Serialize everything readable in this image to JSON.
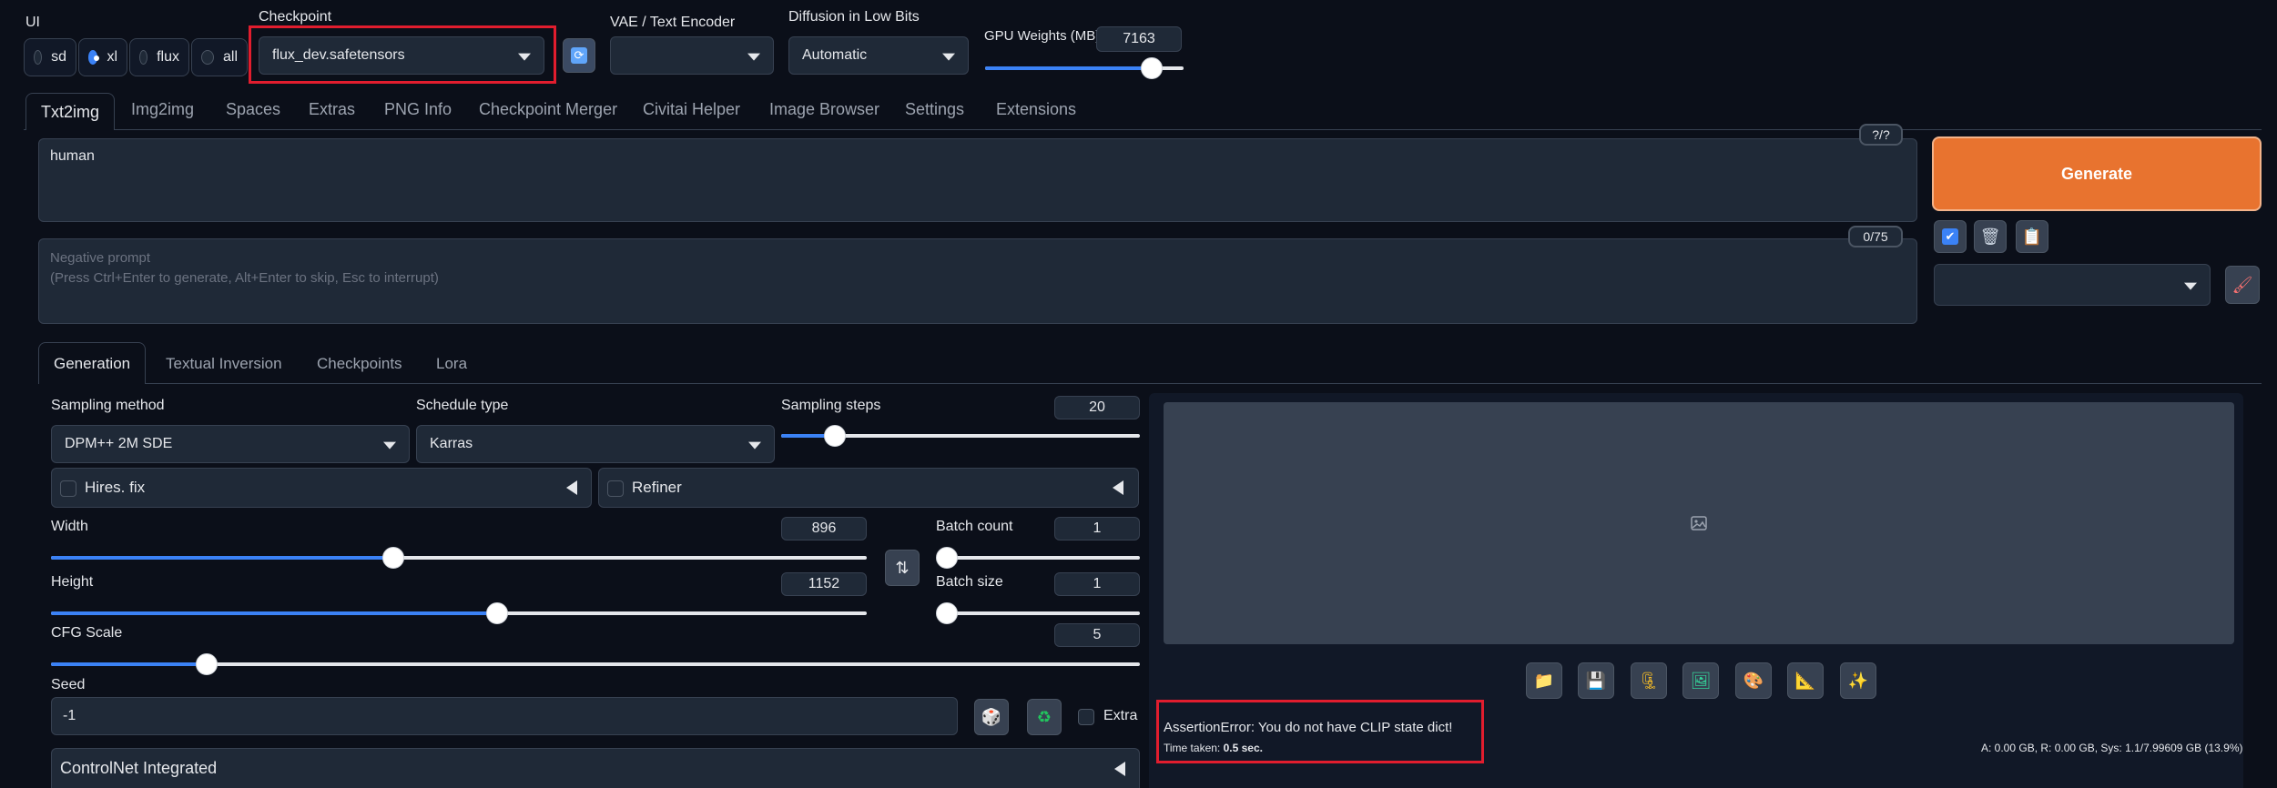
{
  "ui_group": {
    "label": "UI",
    "options": [
      {
        "label": "sd",
        "selected": false
      },
      {
        "label": "xl",
        "selected": true
      },
      {
        "label": "flux",
        "selected": false
      },
      {
        "label": "all",
        "selected": false
      }
    ]
  },
  "checkpoint": {
    "label": "Checkpoint",
    "value": "flux_dev.safetensors"
  },
  "vae": {
    "label": "VAE / Text Encoder",
    "value": ""
  },
  "lowbits": {
    "label": "Diffusion in Low Bits",
    "value": "Automatic"
  },
  "gpu": {
    "label": "GPU Weights (MB)",
    "value": "7163",
    "fraction": 0.84
  },
  "main_tabs": [
    "Txt2img",
    "Img2img",
    "Spaces",
    "Extras",
    "PNG Info",
    "Checkpoint Merger",
    "Civitai Helper",
    "Image Browser",
    "Settings",
    "Extensions"
  ],
  "prompt": {
    "value": "human",
    "counter": "?/?"
  },
  "negative": {
    "placeholder_line1": "Negative prompt",
    "placeholder_line2": "(Press Ctrl+Enter to generate, Alt+Enter to skip, Esc to interrupt)",
    "counter": "0/75"
  },
  "generate_label": "Generate",
  "sub_tabs": [
    "Generation",
    "Textual Inversion",
    "Checkpoints",
    "Lora"
  ],
  "sampling_method": {
    "label": "Sampling method",
    "value": "DPM++ 2M SDE"
  },
  "schedule_type": {
    "label": "Schedule type",
    "value": "Karras"
  },
  "sampling_steps": {
    "label": "Sampling steps",
    "value": "20",
    "fraction": 0.15
  },
  "hires": {
    "label": "Hires. fix"
  },
  "refiner": {
    "label": "Refiner"
  },
  "width": {
    "label": "Width",
    "value": "896",
    "fraction": 0.42
  },
  "height": {
    "label": "Height",
    "value": "1152",
    "fraction": 0.547
  },
  "batch_count": {
    "label": "Batch count",
    "value": "1",
    "fraction": 0.0
  },
  "batch_size": {
    "label": "Batch size",
    "value": "1",
    "fraction": 0.0
  },
  "cfg": {
    "label": "CFG Scale",
    "value": "5",
    "fraction": 0.143
  },
  "seed": {
    "label": "Seed",
    "value": "-1",
    "extra_label": "Extra"
  },
  "controlnet": {
    "label": "ControlNet Integrated"
  },
  "error": {
    "message": "AssertionError: You do not have CLIP state dict!",
    "time_label": "Time taken:",
    "time_value": "0.5 sec."
  },
  "memory": {
    "text": "A: 0.00 GB, R: 0.00 GB, Sys: 1.1/7.99609 GB (13.9%)"
  },
  "icons": [
    "refresh-icon",
    "folder-icon",
    "save-icon",
    "zip-icon",
    "image-icon",
    "palette-icon",
    "ruler-icon",
    "sparkle-icon",
    "dice-icon",
    "recycle-icon",
    "swap-icon",
    "brush-icon",
    "checkbox-icon",
    "trash-icon",
    "clipboard-icon"
  ],
  "colors": {
    "accent": "#3b82f6",
    "generate": "#e8732f",
    "error_box": "#e11d2e",
    "background": "#0b0f19"
  }
}
